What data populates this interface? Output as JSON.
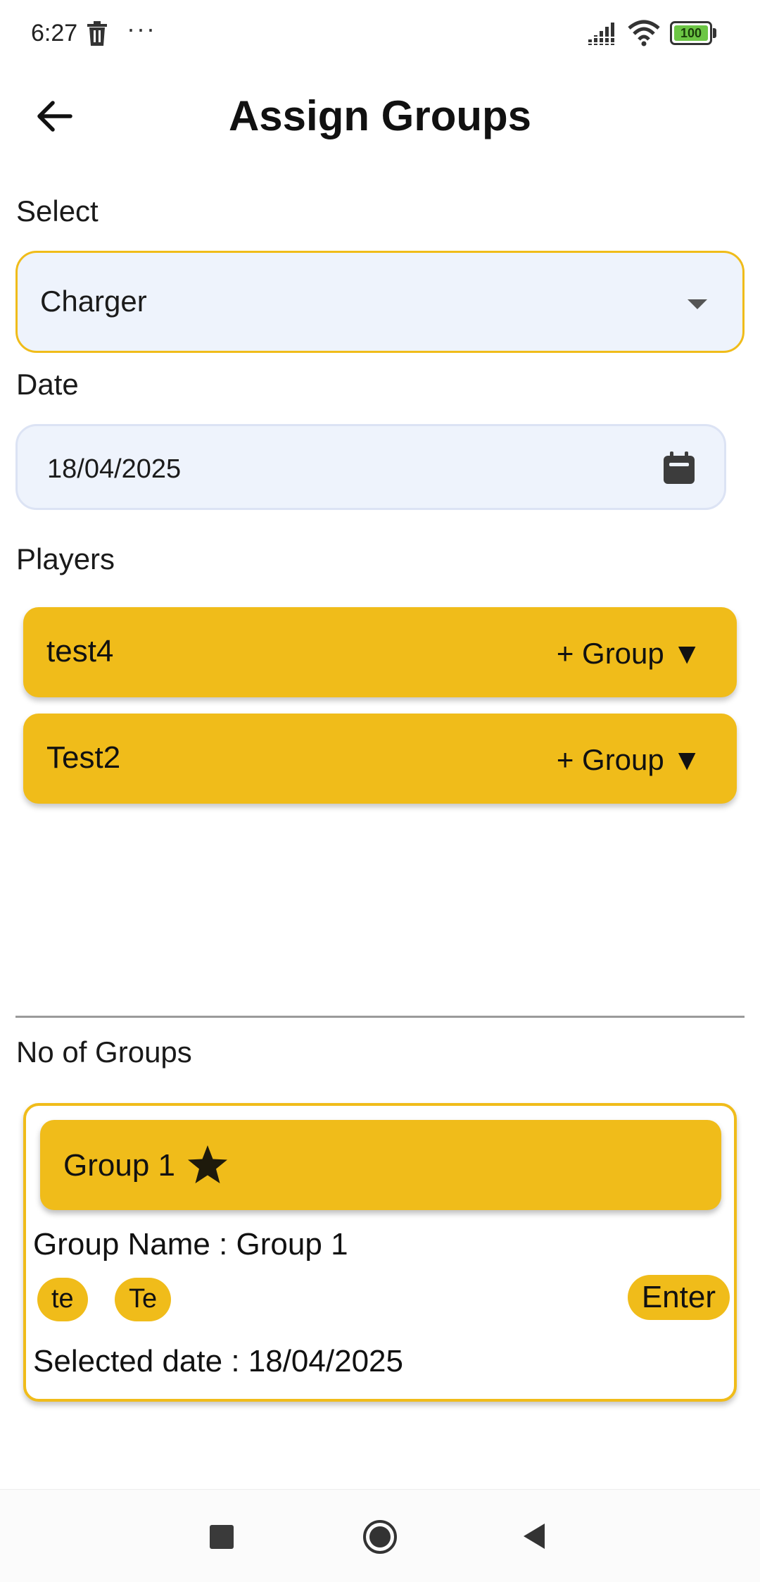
{
  "status_bar": {
    "time": "6:27",
    "dots": "···",
    "battery": "100",
    "icons": [
      "trash-icon",
      "signal-icon",
      "wifi-icon",
      "battery-icon"
    ]
  },
  "app_bar": {
    "title": "Assign Groups",
    "back_icon": "arrow-left-icon"
  },
  "select": {
    "label": "Select",
    "value": "Charger"
  },
  "date": {
    "label": "Date",
    "value": "18/04/2025",
    "icon": "calendar-icon"
  },
  "players": {
    "label": "Players",
    "items": [
      {
        "name": "test4",
        "action": "+ Group ▼"
      },
      {
        "name": "Test2",
        "action": "+ Group ▼"
      }
    ]
  },
  "groups": {
    "label": "No of Groups",
    "items": [
      {
        "title": "Group 1",
        "name_line": "Group Name : Group 1",
        "members": [
          "te",
          "Te"
        ],
        "enter_label": "Enter",
        "selected_date_line": "Selected date : 18/04/2025"
      }
    ]
  },
  "colors": {
    "accent": "#f0bc1a",
    "field_bg": "#eef3fc",
    "text": "#111111"
  },
  "nav_bar": {
    "icons": [
      "recents-icon",
      "home-icon",
      "back-triangle-icon"
    ]
  }
}
